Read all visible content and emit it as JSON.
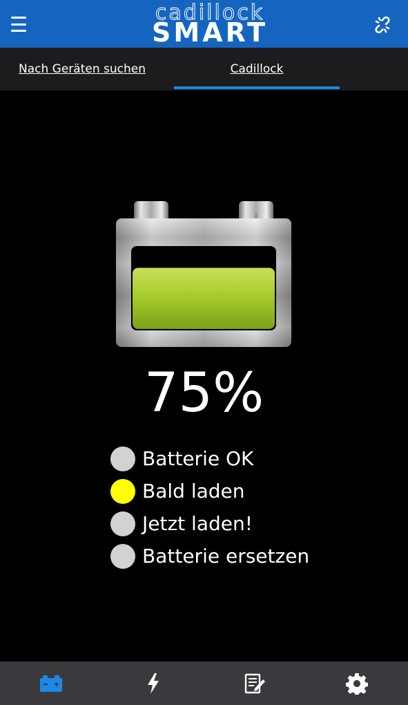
{
  "header": {
    "brand_top": "cadillock",
    "brand_bottom": "SMART",
    "menu_icon": "hamburger-menu-icon",
    "link_icon": "broken-link-icon",
    "color": "#1565c0"
  },
  "tabs": [
    {
      "label": "Nach Geräten suchen",
      "active": false
    },
    {
      "label": "Cadillock",
      "active": true
    }
  ],
  "battery": {
    "level_fraction": 0.75,
    "percent_text": "75%",
    "fill_color": "#a4c92a"
  },
  "status": [
    {
      "label": "Batterie OK",
      "active": false
    },
    {
      "label": "Bald laden",
      "active": true
    },
    {
      "label": "Jetzt laden!",
      "active": false
    },
    {
      "label": "Batterie ersetzen",
      "active": false
    }
  ],
  "colors": {
    "indicator_inactive": "#d2d2d2",
    "indicator_active": "#ffff00",
    "nav_active": "#1e88e5",
    "nav_inactive": "#ffffff"
  },
  "bottom_nav": [
    {
      "icon": "battery-icon",
      "active": true
    },
    {
      "icon": "lightning-icon",
      "active": false
    },
    {
      "icon": "notes-edit-icon",
      "active": false
    },
    {
      "icon": "gear-icon",
      "active": false
    }
  ]
}
